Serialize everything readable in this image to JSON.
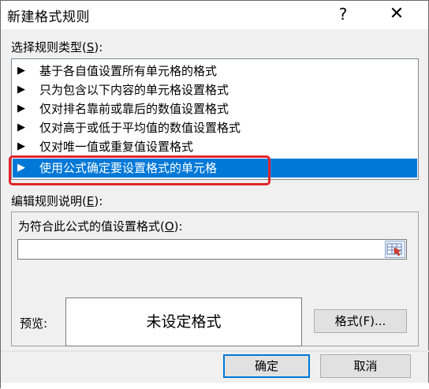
{
  "dialog": {
    "title": "新建格式规则",
    "help_icon": "?",
    "close_icon": "✕"
  },
  "rule_type": {
    "label_prefix": "选择规则类型(",
    "hotkey": "S",
    "label_suffix": "):",
    "items": [
      {
        "marker": "▶",
        "label": "基于各自值设置所有单元格的格式"
      },
      {
        "marker": "▶",
        "label": "只为包含以下内容的单元格设置格式"
      },
      {
        "marker": "▶",
        "label": "仅对排名靠前或靠后的数值设置格式"
      },
      {
        "marker": "▶",
        "label": "仅对高于或低于平均值的数值设置格式"
      },
      {
        "marker": "▶",
        "label": "仅对唯一值或重复值设置格式"
      },
      {
        "marker": "▶",
        "label": "使用公式确定要设置格式的单元格"
      }
    ],
    "selected_index": 5
  },
  "rule_desc": {
    "label_prefix": "编辑规则说明(",
    "hotkey": "E",
    "label_suffix": "):",
    "formula_label_prefix": "为符合此公式的值设置格式(",
    "formula_hotkey": "O",
    "formula_label_suffix": "):",
    "formula_value": "",
    "preview_label": "预览:",
    "preview_text": "未设定格式",
    "format_button": "格式(F)..."
  },
  "footer": {
    "ok": "确定",
    "cancel": "取消"
  },
  "colors": {
    "selection": "#0078d7",
    "annotation_border": "#e0262a"
  }
}
